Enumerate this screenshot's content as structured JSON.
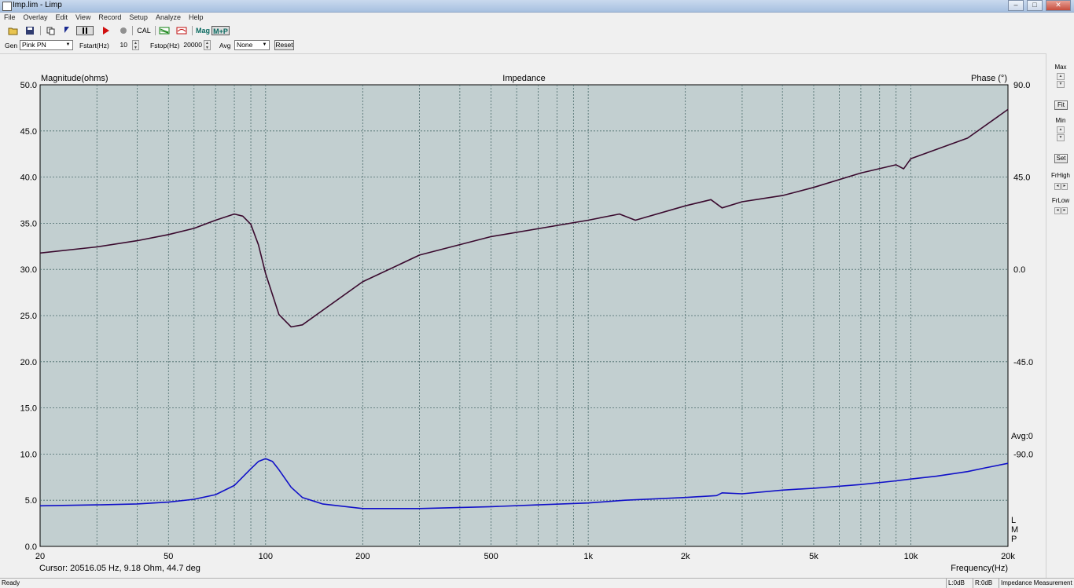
{
  "window": {
    "title": "Imp.lim - Limp"
  },
  "menu": [
    "File",
    "Overlay",
    "Edit",
    "View",
    "Record",
    "Setup",
    "Analyze",
    "Help"
  ],
  "toolbar": {
    "cal_label": "CAL",
    "mag_label": "Mag",
    "mp_label": "M+P"
  },
  "controls": {
    "gen_label": "Gen",
    "gen_value": "Pink PN",
    "fstart_label": "Fstart(Hz)",
    "fstart_value": "10",
    "fstop_label": "Fstop(Hz)",
    "fstop_value": "20000",
    "avg_label": "Avg",
    "avg_value": "None",
    "reset_label": "Reset"
  },
  "right_panel": {
    "max_label": "Max",
    "fit_label": "Fit",
    "min_label": "Min",
    "set_label": "Set",
    "frhigh_label": "FrHigh",
    "frlow_label": "FrLow"
  },
  "chart_data": {
    "type": "line",
    "title": "Impedance",
    "ylabel": "Magnitude(ohms)",
    "y2label": "Phase (°)",
    "xlabel": "Frequency(Hz)",
    "xscale": "log",
    "xlim": [
      20,
      20000
    ],
    "ylim": [
      0,
      50
    ],
    "y2lim": [
      -135,
      90
    ],
    "grid": true,
    "background": "#c2cfd0",
    "yticks": [
      "50.0",
      "45.0",
      "40.0",
      "35.0",
      "30.0",
      "25.0",
      "20.0",
      "15.0",
      "10.0",
      "5.0",
      "0.0"
    ],
    "y2ticks": [
      "90.0",
      "45.0",
      "0.0",
      "-45.0",
      "-90.0"
    ],
    "xticks": [
      {
        "value": 20,
        "label": "20"
      },
      {
        "value": 50,
        "label": "50"
      },
      {
        "value": 100,
        "label": "100"
      },
      {
        "value": 200,
        "label": "200"
      },
      {
        "value": 500,
        "label": "500"
      },
      {
        "value": 1000,
        "label": "1k"
      },
      {
        "value": 2000,
        "label": "2k"
      },
      {
        "value": 5000,
        "label": "5k"
      },
      {
        "value": 10000,
        "label": "10k"
      },
      {
        "value": 20000,
        "label": "20k"
      }
    ],
    "avg_annotation": "Avg:0",
    "lmp_letters": [
      "L",
      "M",
      "P"
    ],
    "cursor_readout": "Cursor: 20516.05 Hz, 9.18 Ohm, 44.7 deg",
    "series": [
      {
        "axis": "left",
        "color": "#1010c8",
        "x": [
          20,
          30,
          40,
          50,
          60,
          70,
          80,
          90,
          95,
          100,
          105,
          110,
          120,
          130,
          150,
          200,
          300,
          500,
          700,
          1000,
          1300,
          2000,
          2500,
          2600,
          3000,
          4000,
          5000,
          7000,
          9000,
          10000,
          12000,
          15000,
          17000,
          20000
        ],
        "y": [
          4.4,
          4.5,
          4.6,
          4.8,
          5.1,
          5.6,
          6.6,
          8.4,
          9.2,
          9.5,
          9.2,
          8.3,
          6.4,
          5.3,
          4.6,
          4.1,
          4.1,
          4.3,
          4.5,
          4.7,
          5.0,
          5.3,
          5.5,
          5.8,
          5.7,
          6.1,
          6.3,
          6.7,
          7.1,
          7.3,
          7.6,
          8.1,
          8.5,
          9.0
        ]
      },
      {
        "axis": "right",
        "color": "#3a0a2e",
        "x": [
          20,
          30,
          40,
          50,
          60,
          70,
          80,
          85,
          90,
          95,
          100,
          110,
          120,
          130,
          150,
          200,
          300,
          500,
          1000,
          1250,
          1400,
          2000,
          2400,
          2600,
          3000,
          4000,
          5000,
          7000,
          9000,
          9500,
          10000,
          15000,
          20000
        ],
        "y": [
          8,
          11,
          14,
          17,
          20,
          24,
          27,
          26,
          22,
          12,
          -2,
          -22,
          -28,
          -27,
          -20,
          -6,
          7,
          16,
          24,
          27,
          24,
          31,
          34,
          30,
          33,
          36,
          40,
          47,
          51,
          49,
          54,
          64,
          78
        ]
      }
    ]
  },
  "status": {
    "ready": "Ready",
    "left": "L:0dB",
    "right": "R:0dB",
    "mode": "Impedance Measurement"
  }
}
